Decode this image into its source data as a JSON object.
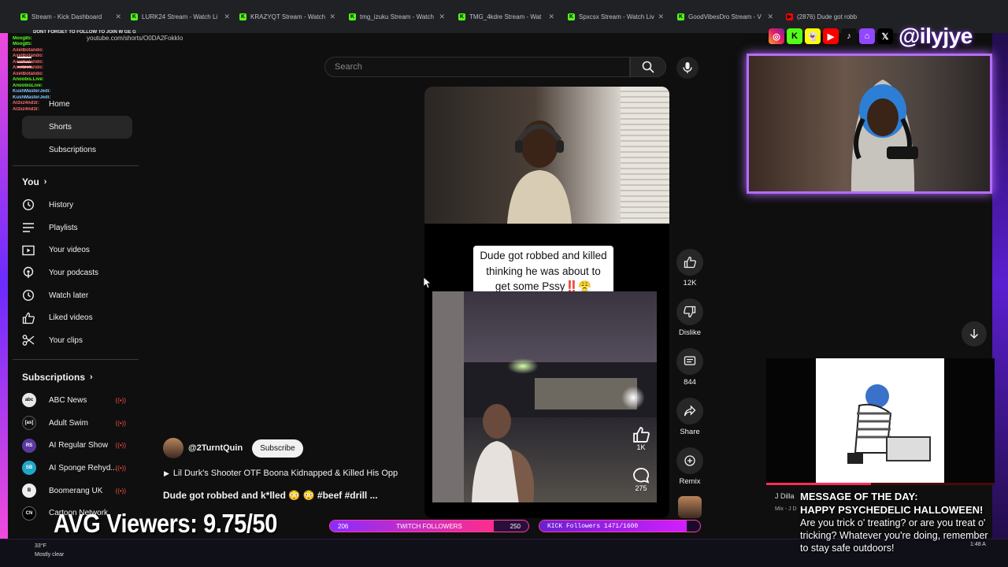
{
  "browser": {
    "tabs": [
      {
        "label": "Stream - Kick Dashboard",
        "icon": "kick-icon"
      },
      {
        "label": "LURK24 Stream - Watch Li",
        "icon": "kick-icon"
      },
      {
        "label": "KRAZYQT Stream - Watch",
        "icon": "kick-icon"
      },
      {
        "label": "tmg_izuku Stream - Watch",
        "icon": "kick-icon"
      },
      {
        "label": "TMG_4kdre Stream - Wat",
        "icon": "kick-icon"
      },
      {
        "label": "Spxcsx Stream - Watch Liv",
        "icon": "kick-icon"
      },
      {
        "label": "GoodVibesDro Stream - V",
        "icon": "kick-icon"
      },
      {
        "label": "(2876) Dude got robb",
        "icon": "youtube-icon"
      }
    ],
    "url": "youtube.com/shorts/O0DA2FokkIo"
  },
  "chat": {
    "banner": "DONT FORGET TO FOLLOW TO JOIN W GE G",
    "lines": [
      {
        "user": "Moog85:",
        "color": "g"
      },
      {
        "user": "Moog85:",
        "color": "g"
      },
      {
        "user": "AxelBotando:",
        "color": "r"
      },
      {
        "user": "AxelBotando:",
        "color": "r"
      },
      {
        "user": "AxelBotando:",
        "color": "r"
      },
      {
        "user": "AxelBotando:",
        "color": "r"
      },
      {
        "user": "AxelBotando:",
        "color": "r"
      },
      {
        "user": "Anoobis.Live:",
        "color": "g"
      },
      {
        "user": "AnoobisLive:",
        "color": "g"
      },
      {
        "user": "KushMasterJedi:",
        "color": "b"
      },
      {
        "user": "KushMasterJedi:",
        "color": "b"
      },
      {
        "user": "Al3xz4nd3r:",
        "color": "r"
      },
      {
        "user": "Al3xz4nd3r:",
        "color": "r"
      }
    ]
  },
  "nav": {
    "top": [
      {
        "label": "Home",
        "icon": "home-icon"
      },
      {
        "label": "Shorts",
        "icon": "shorts-icon"
      },
      {
        "label": "Subscriptions",
        "icon": "subscriptions-icon"
      }
    ],
    "you_header": "You",
    "you_items": [
      {
        "label": "History",
        "icon": "history-icon"
      },
      {
        "label": "Playlists",
        "icon": "playlists-icon"
      },
      {
        "label": "Your videos",
        "icon": "your-videos-icon"
      },
      {
        "label": "Your podcasts",
        "icon": "podcasts-icon"
      },
      {
        "label": "Watch later",
        "icon": "watch-later-icon"
      },
      {
        "label": "Liked videos",
        "icon": "liked-icon"
      },
      {
        "label": "Your clips",
        "icon": "clips-icon"
      }
    ],
    "subs_header": "Subscriptions",
    "subs": [
      {
        "label": "ABC News",
        "color": "#e8e8e8",
        "abbr": "abc"
      },
      {
        "label": "Adult Swim",
        "color": "#111111",
        "abbr": "[as]"
      },
      {
        "label": "AI Regular Show",
        "color": "#5a3aa0",
        "abbr": "RS"
      },
      {
        "label": "AI Sponge Rehyd...",
        "color": "#1fa7c9",
        "abbr": "SB"
      },
      {
        "label": "Boomerang UK",
        "color": "#eeeeee",
        "abbr": "B"
      },
      {
        "label": "Cartoon Network",
        "color": "#000000",
        "abbr": "CN"
      }
    ]
  },
  "search": {
    "placeholder": "Search"
  },
  "short": {
    "caption": "Dude got robbed and killed thinking he was about to get some Pssy‼️😤",
    "channel": "@2TurntQuin",
    "subscribe_label": "Subscribe",
    "playlist": "Lil Durk's Shooter OTF Boona Kidnapped & Killed His Opp",
    "title": "Dude got robbed and k*lled 😳 😳 #beef #drill ...",
    "inline_like": "1K",
    "inline_comments": "275"
  },
  "actions": {
    "like_count": "12K",
    "dislike_label": "Dislike",
    "comments_count": "844",
    "share_label": "Share",
    "remix_label": "Remix"
  },
  "overlay": {
    "handle": "@ilyjye",
    "now_playing": "J Dilla",
    "now_playing_sub": "Mix - J D",
    "music_progress": 0.46,
    "motd_title": "MESSAGE OF THE DAY:",
    "motd_line1": "HAPPY PSYCHEDELIC HALLOWEEN!",
    "motd_body": "Are you trick o' treating? or are you treat o' tricking? Whatever you're doing, remember to stay safe outdoors!",
    "avg_viewers": "AVG Viewers: 9.75/50",
    "twitch": {
      "current": "206",
      "label": "TWITCH FOLLOWERS",
      "goal": "250",
      "progress": 0.824
    },
    "kick": {
      "label": "KICK Followers 1471/1600",
      "progress": 0.919
    },
    "weather_temp": "33°F",
    "weather_desc": "Mostly clear",
    "clock": "1:48 A"
  }
}
